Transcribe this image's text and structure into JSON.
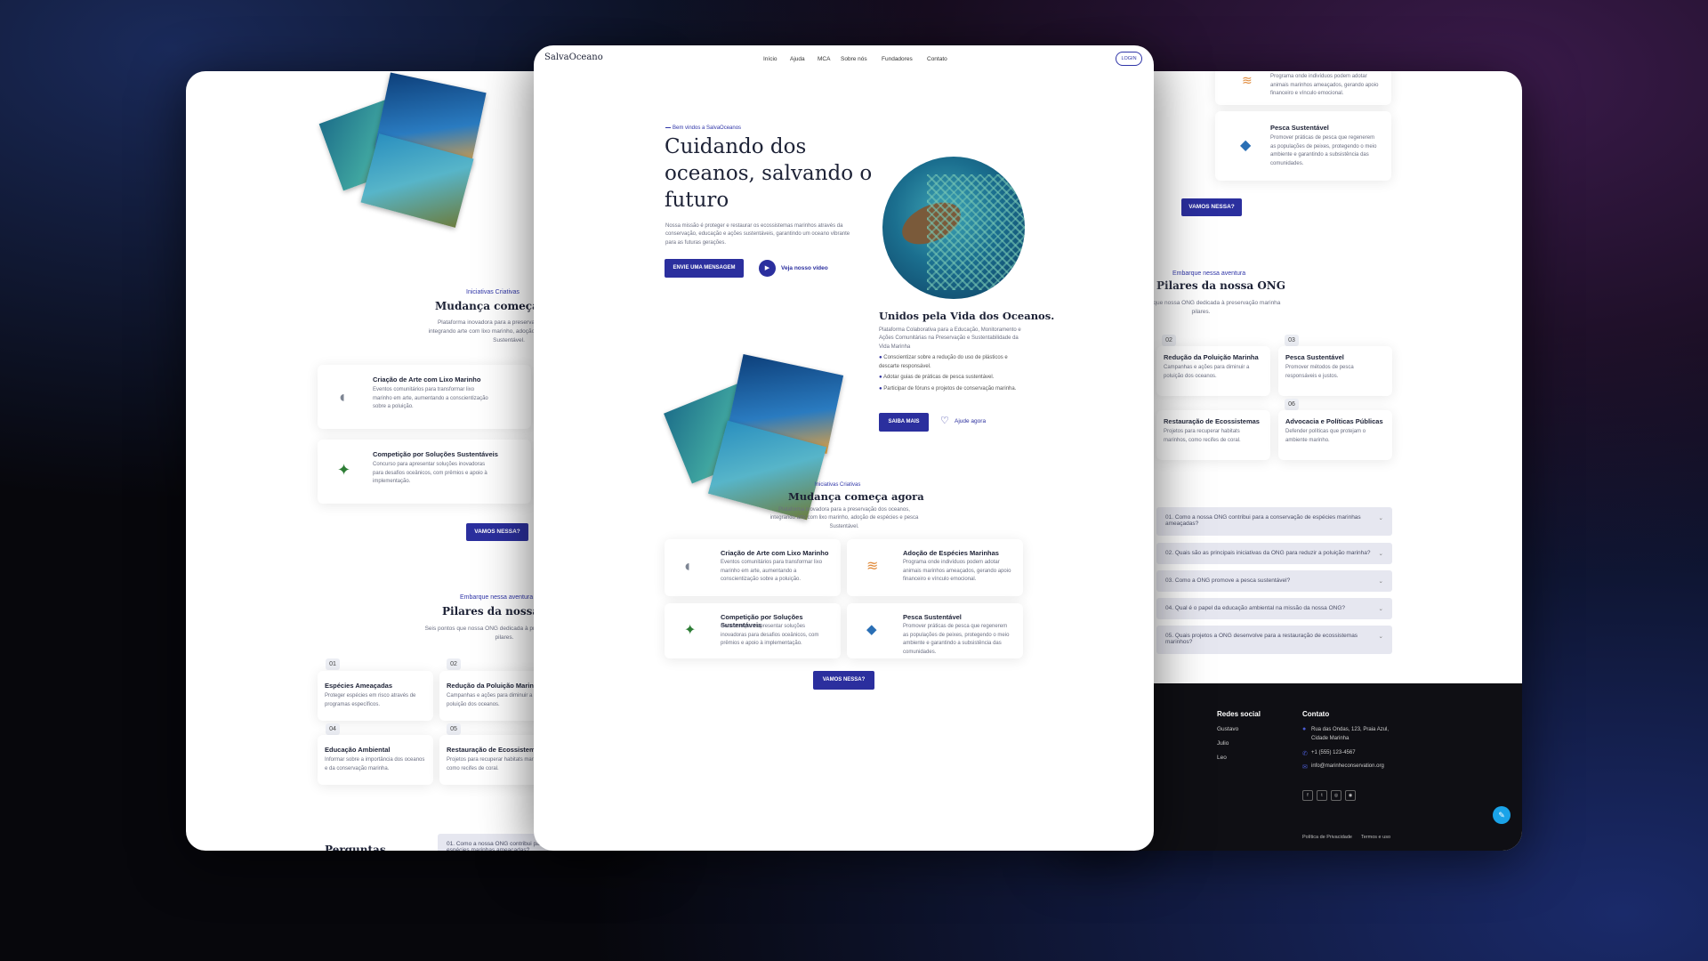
{
  "brand": "SalvaOceano",
  "nav": {
    "items": [
      "Início",
      "Ajuda",
      "MCA",
      "Sobre nós",
      "Fundadores",
      "Contato"
    ],
    "login": "LOGIN"
  },
  "hero": {
    "eyebrow": "Bem vindos a SalvaOceanos",
    "title_lines": [
      "Cuidando dos",
      "oceanos, salvando o",
      "futuro"
    ],
    "text": "Nossa missão é proteger e restaurar os ecossistemas marinhos através da conservação, educação e ações sustentáveis, garantindo um oceano vibrante para as futuras gerações.",
    "cta": "ENVIE UMA MENSAGEM",
    "video": "Veja nosso vídeo"
  },
  "unidos": {
    "title": "Unidos pela Vida dos Oceanos.",
    "text": "Plataforma Colaborativa para a Educação, Monitoramento e Ações Comunitárias na Preservação e Sustentabilidade da Vida Marinha",
    "bullets": [
      "Conscientizar sobre a redução do uso de plásticos e descarte responsável.",
      "Adotar guias de práticas de pesca sustentável.",
      "Participar de fóruns e projetos de conservação marinha."
    ],
    "btn": "SAIBA MAIS",
    "help": "Ajude agora"
  },
  "iniciativas": {
    "eyebrow": "Iniciativas Criativas",
    "title": "Mudança começa agora",
    "text": "Plataforma inovadora para a preservação dos oceanos, integrando arte com lixo marinho, adoção de espécies e pesca Sustentável.",
    "cards": [
      {
        "title": "Criação de Arte com Lixo Marinho",
        "text": "Eventos comunitários para transformar lixo marinho em arte, aumentando a conscientização sobre a poluição.",
        "icon": "seal-icon"
      },
      {
        "title": "Adoção de Espécies Marinhas",
        "text": "Programa onde indivíduos podem adotar animais marinhos ameaçados, gerando apoio financeiro e vínculo emocional.",
        "icon": "jellyfish-icon"
      },
      {
        "title": "Competição por Soluções Sustentáveis",
        "text": "Concurso para apresentar soluções inovadoras para desafios oceânicos, com prêmios e apoio à implementação.",
        "icon": "turtle-icon"
      },
      {
        "title": "Pesca Sustentável",
        "text": "Promover práticas de pesca que regenerem as populações de peixes, protegendo o meio ambiente e garantindo a subsistência das comunidades.",
        "icon": "fish-icon"
      }
    ],
    "btn": "VAMOS NESSA?"
  },
  "pilares": {
    "eyebrow": "Embarque nessa aventura",
    "title": "Pilares da nossa ONG",
    "text": "Seis pontos que nossa ONG dedicada à preservação marinha pilares.",
    "items": [
      {
        "num": "01",
        "title": "Espécies Ameaçadas",
        "text": "Proteger espécies em risco através de programas específicos."
      },
      {
        "num": "02",
        "title": "Redução da Poluição Marinha",
        "text": "Campanhas e ações para diminuir a poluição dos oceanos."
      },
      {
        "num": "03",
        "title": "Pesca Sustentável",
        "text": "Promover métodos de pesca responsáveis e justos."
      },
      {
        "num": "04",
        "title": "Educação Ambiental",
        "text": "Informar sobre a importância dos oceanos e da conservação marinha."
      },
      {
        "num": "05",
        "title": "Restauração de Ecossistemas",
        "text": "Projetos para recuperar habitats marinhos, como recifes de coral."
      },
      {
        "num": "06",
        "title": "Advocacia e Políticas Públicas",
        "text": "Defender políticas que protejam o ambiente marinho."
      }
    ]
  },
  "faq": [
    "01. Como a nossa ONG contribui para a conservação de espécies marinhas ameaçadas?",
    "02. Quais são as principais iniciativas da ONG para reduzir a poluição marinha?",
    "03. Como a ONG promove a pesca sustentável?",
    "04. Qual é o papel da educação ambiental na missão da nossa ONG?",
    "05. Quais projetos a ONG desenvolve para a restauração de ecossistemas marinhos?"
  ],
  "perguntas": "Perguntas",
  "footer": {
    "social_title": "Redes social",
    "social": [
      "Gustavo",
      "Julio",
      "Leo"
    ],
    "contact_title": "Contato",
    "address": "Rua das Ondas, 123, Praia Azul, Cidade Marinha",
    "phone": "+1 (555) 123-4567",
    "email": "info@marinheconservation.org",
    "links": [
      "Política de Privacidade",
      "Termos e uso"
    ]
  }
}
